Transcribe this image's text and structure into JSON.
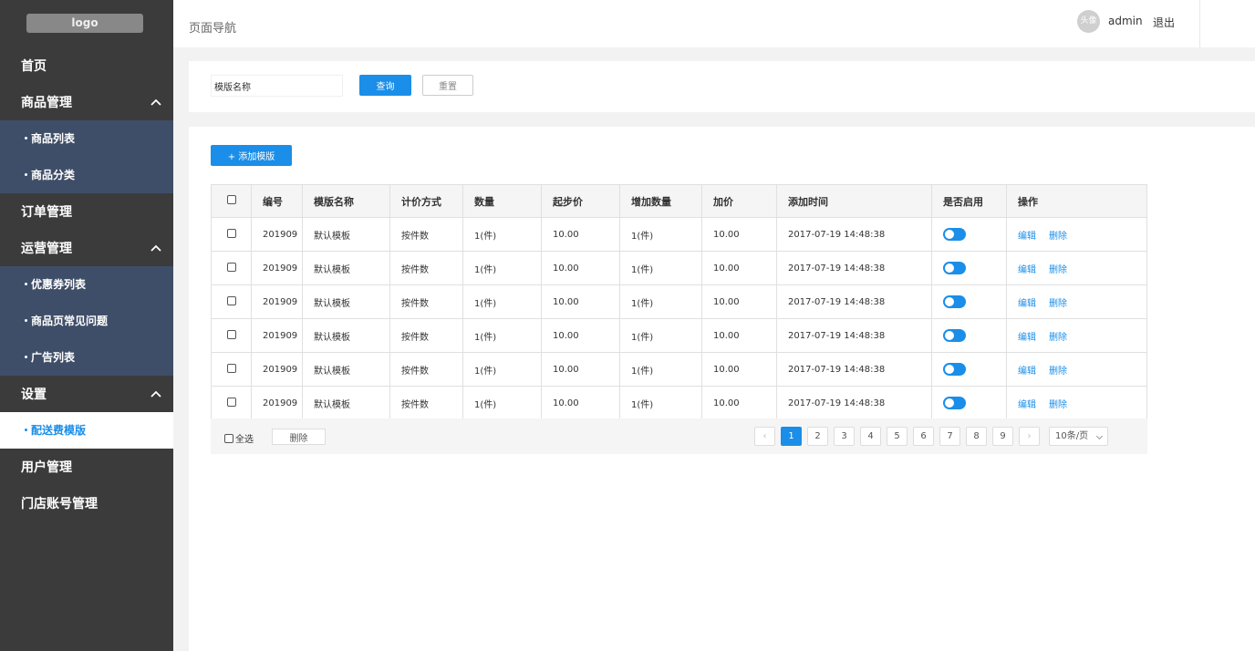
{
  "sidebar": {
    "logo": "logo",
    "menu": [
      {
        "label": "首页"
      },
      {
        "label": "商品管理",
        "expanded": true,
        "children": [
          "商品列表",
          "商品分类"
        ]
      },
      {
        "label": "订单管理"
      },
      {
        "label": "运营管理",
        "expanded": true,
        "children": [
          "优惠券列表",
          "商品页常见问题",
          "广告列表"
        ]
      },
      {
        "label": "设置",
        "expanded": true,
        "children": [
          "配送费模版"
        ]
      },
      {
        "label": "用户管理"
      },
      {
        "label": "门店账号管理"
      }
    ],
    "active_item": "配送费模版"
  },
  "header": {
    "page_nav": "页面导航",
    "avatar_text": "头像",
    "username": "admin",
    "logout": "退出"
  },
  "search": {
    "value": "模版名称",
    "query_label": "查询",
    "reset_label": "重置"
  },
  "add_button": "+ 添加模版",
  "table": {
    "columns": [
      "编号",
      "模版名称",
      "计价方式",
      "数量",
      "起步价",
      "增加数量",
      "加价",
      "添加时间",
      "是否启用",
      "操作"
    ],
    "rows": [
      {
        "id": "201909",
        "name": "默认模板",
        "pricing": "按件数",
        "qty": "1(件)",
        "base": "10.00",
        "inc_qty": "1(件)",
        "inc_price": "10.00",
        "time": "2017-07-19 14:48:38",
        "enabled": true
      },
      {
        "id": "201909",
        "name": "默认模板",
        "pricing": "按件数",
        "qty": "1(件)",
        "base": "10.00",
        "inc_qty": "1(件)",
        "inc_price": "10.00",
        "time": "2017-07-19 14:48:38",
        "enabled": true
      },
      {
        "id": "201909",
        "name": "默认模板",
        "pricing": "按件数",
        "qty": "1(件)",
        "base": "10.00",
        "inc_qty": "1(件)",
        "inc_price": "10.00",
        "time": "2017-07-19 14:48:38",
        "enabled": true
      },
      {
        "id": "201909",
        "name": "默认模板",
        "pricing": "按件数",
        "qty": "1(件)",
        "base": "10.00",
        "inc_qty": "1(件)",
        "inc_price": "10.00",
        "time": "2017-07-19 14:48:38",
        "enabled": true
      },
      {
        "id": "201909",
        "name": "默认模板",
        "pricing": "按件数",
        "qty": "1(件)",
        "base": "10.00",
        "inc_qty": "1(件)",
        "inc_price": "10.00",
        "time": "2017-07-19 14:48:38",
        "enabled": true
      },
      {
        "id": "201909",
        "name": "默认模板",
        "pricing": "按件数",
        "qty": "1(件)",
        "base": "10.00",
        "inc_qty": "1(件)",
        "inc_price": "10.00",
        "time": "2017-07-19 14:48:38",
        "enabled": true
      }
    ],
    "edit_label": "编辑",
    "delete_label": "删除"
  },
  "footer": {
    "select_all": "全选",
    "delete_label": "删除",
    "pages": [
      "1",
      "2",
      "3",
      "4",
      "5",
      "6",
      "7",
      "8",
      "9"
    ],
    "current_page": "1",
    "prev": "‹",
    "next": "›",
    "page_size": "10条/页"
  },
  "colors": {
    "accent": "#1a8ee8",
    "sidebar_bg": "#3b3b3b",
    "submenu_bg": "#3f4e68"
  }
}
